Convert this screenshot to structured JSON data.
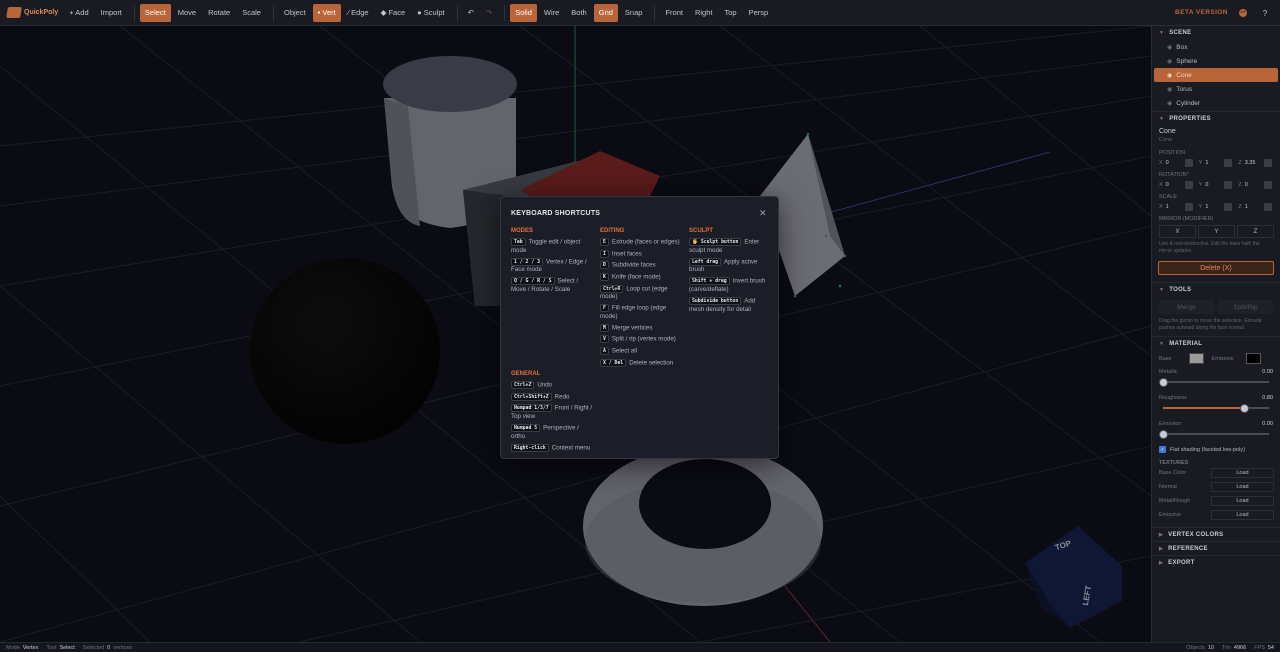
{
  "app": {
    "name": "QuickPoly",
    "beta": "BETA VERSION"
  },
  "toolbar": {
    "add": "+ Add",
    "import": "Import",
    "transform": [
      "Select",
      "Move",
      "Rotate",
      "Scale"
    ],
    "modes": [
      "Object",
      "• Vert",
      "⁄ Edge",
      "◆ Face",
      "● Sculpt"
    ],
    "display": [
      "Solid",
      "Wire",
      "Both",
      "Grid",
      "Snap"
    ],
    "views": [
      "Front",
      "Right",
      "Top",
      "Persp"
    ],
    "active": [
      "Select",
      "• Vert",
      "Solid",
      "Grid"
    ],
    "undo_icon": "undo-icon",
    "redo_icon": "redo-icon",
    "theme_icon": "palette-icon",
    "help_label": "?"
  },
  "viewcube": {
    "top": "TOP",
    "left": "LEFT"
  },
  "shortcuts": {
    "title": "KEYBOARD SHORTCUTS",
    "modes": {
      "heading": "MODES",
      "items": [
        {
          "key": "Tab",
          "desc": "Toggle edit / object mode"
        },
        {
          "key": "1 / 2 / 3",
          "desc": "Vertex / Edge / Face mode"
        },
        {
          "key": "Q / G / R / S",
          "desc": "Select / Move / Rotate / Scale"
        }
      ]
    },
    "editing": {
      "heading": "EDITING",
      "items": [
        {
          "key": "E",
          "desc": "Extrude (faces or edges)"
        },
        {
          "key": "I",
          "desc": "Inset faces"
        },
        {
          "key": "D",
          "desc": "Subdivide faces"
        },
        {
          "key": "K",
          "desc": "Knife (face mode)"
        },
        {
          "key": "Ctrl+R",
          "desc": "Loop cut (edge mode)"
        },
        {
          "key": "F",
          "desc": "Fill edge loop (edge mode)"
        },
        {
          "key": "M",
          "desc": "Merge vertices"
        },
        {
          "key": "V",
          "desc": "Split / rip (vertex mode)"
        },
        {
          "key": "A",
          "desc": "Select all"
        },
        {
          "key": "X / Del",
          "desc": "Delete selection"
        }
      ]
    },
    "sculpt": {
      "heading": "SCULPT",
      "items": [
        {
          "key": "🖐 Sculpt button",
          "desc": "Enter sculpt mode"
        },
        {
          "key": "Left drag",
          "desc": "Apply active brush"
        },
        {
          "key": "Shift + drag",
          "desc": "Invert brush (carve/deflate)"
        },
        {
          "key": "Subdivide button",
          "desc": "Add mesh density for detail"
        }
      ]
    },
    "general": {
      "heading": "GENERAL",
      "items": [
        {
          "key": "Ctrl+Z",
          "desc": "Undo"
        },
        {
          "key": "Ctrl+Shift+Z",
          "desc": "Redo"
        },
        {
          "key": "Numpad 1/3/7",
          "desc": "Front / Right / Top view"
        },
        {
          "key": "Numpad 5",
          "desc": "Perspective / ortho"
        },
        {
          "key": "Right-click",
          "desc": "Context menu"
        }
      ]
    }
  },
  "panel": {
    "scene": {
      "title": "SCENE",
      "objects": [
        "Box",
        "Sphere",
        "Cone",
        "Torus",
        "Cylinder"
      ],
      "selected": "Cone"
    },
    "properties": {
      "title": "PROPERTIES",
      "name": "Cone",
      "type": "Cone",
      "position_label": "POSITION",
      "position": [
        "0",
        "1",
        "3.35"
      ],
      "rotation_label": "ROTATION°",
      "rotation": [
        "0",
        "0",
        "0"
      ],
      "scale_label": "SCALE",
      "scale": [
        "1",
        "1",
        "1"
      ],
      "axes": [
        "X",
        "Y",
        "Z"
      ],
      "mirror_label": "MIRROR (MODIFIER)",
      "mirror_buttons": [
        "X",
        "Y",
        "Z"
      ],
      "mirror_note": "Live & non-destructive. Edit the base half; the mirror updates.",
      "delete": "Delete (X)"
    },
    "tools": {
      "title": "TOOLS",
      "buttons": [
        "Merge",
        "Split/Rip"
      ],
      "note": "Drag the gizmo to move the selection. Extrude pushes outward along the face normal."
    },
    "material": {
      "title": "MATERIAL",
      "base_label": "Base",
      "emissive_label": "Emissive",
      "base_color": "#9a9a9a",
      "emissive_color": "#000000",
      "metallic_label": "Metallic",
      "metallic": "0.00",
      "roughness_label": "Roughness",
      "roughness": "0.80",
      "emission_label": "Emission",
      "emission": "0.00",
      "flat_label": "Flat shading (faceted low-poly)"
    },
    "textures": {
      "title": "TEXTURES",
      "rows": [
        "Base Color",
        "Normal",
        "Metal/Rough",
        "Emissive"
      ],
      "load": "Load"
    },
    "vertex_colors": "VERTEX COLORS",
    "reference": "REFERENCE",
    "export": "EXPORT"
  },
  "status": {
    "mode_label": "Mode",
    "mode": "Vertex",
    "tool_label": "Tool",
    "tool": "Select",
    "selected_label": "Selected",
    "selected_count": "0",
    "selected_unit": "vertices",
    "objects_label": "Objects",
    "objects": "10",
    "tris_label": "Tris",
    "tris": "4966",
    "fps_label": "FPS",
    "fps": "54"
  },
  "colors": {
    "accent": "#b8653a",
    "background": "#11121f",
    "panel": "#1a1b22"
  }
}
